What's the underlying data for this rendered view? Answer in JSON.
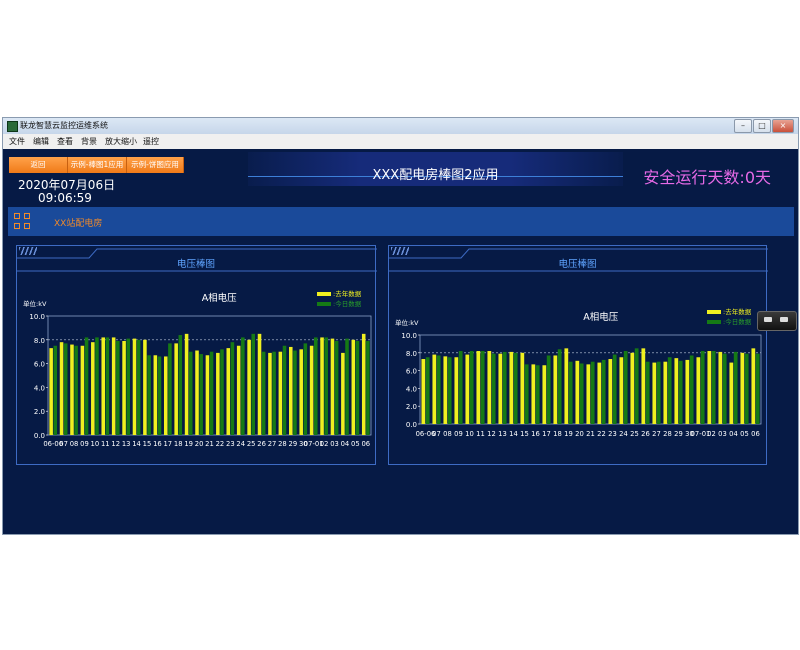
{
  "window": {
    "title": "联龙智慧云监控运维系统",
    "buttons": [
      "–",
      "□",
      "×"
    ]
  },
  "menu": [
    "文件",
    "编辑",
    "查看",
    "背景",
    "放大缩小",
    "遥控"
  ],
  "nav_buttons": [
    "返回",
    "示例-棒图1应用",
    "示例-饼图应用"
  ],
  "datetime": {
    "date": "2020年07月06日",
    "time": "09:06:59"
  },
  "header": {
    "title": "XXX配电房棒图2应用",
    "safe_days": "安全运行天数:0天"
  },
  "site": {
    "name": "XX站配电房",
    "icon": "grid-icon"
  },
  "panels": [
    {
      "title": "电压棒图"
    },
    {
      "title": "电压棒图"
    }
  ],
  "colors": {
    "last_year": "#f0f020",
    "today": "#157a15",
    "accent": "#f08a2a",
    "safe": "#e66ae6"
  },
  "chart_data": [
    {
      "type": "bar",
      "title": "A相电压",
      "unit_label": "单位:kV",
      "ylim": [
        0,
        10
      ],
      "yticks": [
        "0.0",
        "2.0",
        "4.0",
        "6.0",
        "8.0",
        "10.0"
      ],
      "reference_line": 8.0,
      "categories": [
        "06-06",
        "07",
        "08",
        "09",
        "10",
        "11",
        "12",
        "13",
        "14",
        "15",
        "16",
        "17",
        "18",
        "19",
        "20",
        "21",
        "22",
        "23",
        "24",
        "25",
        "26",
        "27",
        "28",
        "29",
        "30",
        "07-01",
        "02",
        "03",
        "04",
        "05",
        "06"
      ],
      "series": [
        {
          "name": ":去年数据",
          "values": [
            7.3,
            7.8,
            7.6,
            7.5,
            7.8,
            8.2,
            8.2,
            7.9,
            8.1,
            8.0,
            6.7,
            6.6,
            7.7,
            8.5,
            7.1,
            6.7,
            6.9,
            7.3,
            7.5,
            8.0,
            8.5,
            6.9,
            7.0,
            7.4,
            7.2,
            7.5,
            8.2,
            8.1,
            6.9,
            8.0,
            8.5
          ]
        },
        {
          "name": ":今日数据",
          "values": [
            7.5,
            7.7,
            7.5,
            8.2,
            8.2,
            8.2,
            7.9,
            8.1,
            8.0,
            6.7,
            6.6,
            7.7,
            8.4,
            7.0,
            6.8,
            7.0,
            7.2,
            7.8,
            8.2,
            8.5,
            7.0,
            7.0,
            7.5,
            7.1,
            7.7,
            8.2,
            8.2,
            7.9,
            8.1,
            7.9,
            7.9
          ]
        }
      ],
      "legend": "top-right",
      "grid": true
    },
    {
      "type": "bar",
      "title": "A相电压",
      "unit_label": "单位:kV",
      "ylim": [
        0,
        10
      ],
      "yticks": [
        "0.0",
        "2.0",
        "4.0",
        "6.0",
        "8.0",
        "10.0"
      ],
      "reference_line": 8.0,
      "categories": [
        "06-06",
        "07",
        "08",
        "09",
        "10",
        "11",
        "12",
        "13",
        "14",
        "15",
        "16",
        "17",
        "18",
        "19",
        "20",
        "21",
        "22",
        "23",
        "24",
        "25",
        "26",
        "27",
        "28",
        "29",
        "30",
        "07-01",
        "02",
        "03",
        "04",
        "05",
        "06"
      ],
      "series": [
        {
          "name": ":去年数据",
          "values": [
            7.3,
            7.8,
            7.6,
            7.5,
            7.8,
            8.2,
            8.2,
            7.9,
            8.1,
            8.0,
            6.7,
            6.6,
            7.7,
            8.5,
            7.1,
            6.7,
            6.9,
            7.3,
            7.5,
            8.0,
            8.5,
            6.9,
            7.0,
            7.4,
            7.2,
            7.5,
            8.2,
            8.1,
            6.9,
            8.0,
            8.5
          ]
        },
        {
          "name": ":今日数据",
          "values": [
            7.5,
            7.7,
            7.5,
            8.2,
            8.2,
            8.2,
            7.9,
            8.1,
            8.0,
            6.7,
            6.6,
            7.7,
            8.4,
            7.0,
            6.8,
            7.0,
            7.2,
            7.8,
            8.2,
            8.5,
            7.0,
            7.0,
            7.5,
            7.1,
            7.7,
            8.2,
            8.2,
            7.9,
            8.1,
            7.9,
            7.9
          ]
        }
      ],
      "legend": "top-right",
      "grid": true
    }
  ]
}
